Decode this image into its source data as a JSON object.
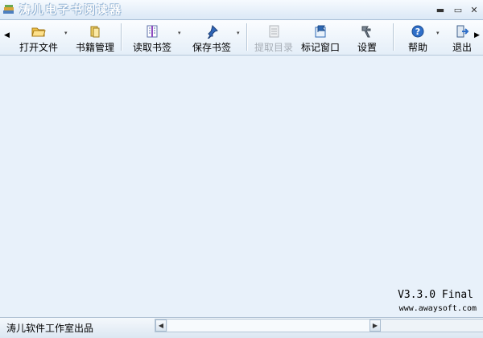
{
  "window": {
    "title": "涛儿电子书阅读器",
    "minimize_glyph": "▬",
    "maximize_glyph": "▭",
    "close_glyph": "✕"
  },
  "toolbar": {
    "scroll_left": "◀",
    "scroll_right": "▶",
    "drop_glyph": "▾",
    "buttons": [
      {
        "label": "打开文件",
        "icon": "folder-open-icon"
      },
      {
        "label": "书籍管理",
        "icon": "books-icon"
      },
      {
        "label": "读取书签",
        "icon": "bookmark-read-icon"
      },
      {
        "label": "保存书签",
        "icon": "pin-save-icon"
      },
      {
        "label": "提取目录",
        "icon": "contents-icon",
        "disabled": true
      },
      {
        "label": "标记窗口",
        "icon": "flag-window-icon"
      },
      {
        "label": "设置",
        "icon": "settings-icon"
      },
      {
        "label": "帮助",
        "icon": "help-icon"
      },
      {
        "label": "退出",
        "icon": "exit-icon"
      }
    ]
  },
  "content": {
    "version": "V3.3.0 Final",
    "website": "www.awaysoft.com"
  },
  "statusbar": {
    "text": "涛儿软件工作室出品",
    "scroll_left": "◀",
    "scroll_right": "▶"
  },
  "colors": {
    "background": "#e8f1fa",
    "title_gradient_top": "#f6fafe",
    "title_gradient_bottom": "#dbe8f6"
  }
}
